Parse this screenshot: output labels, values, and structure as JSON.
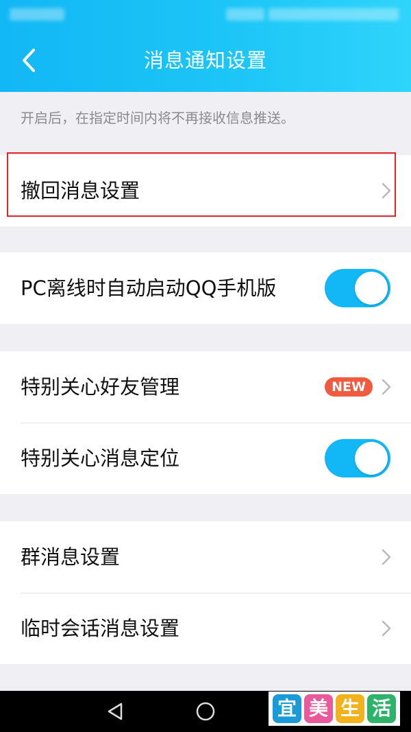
{
  "header": {
    "title": "消息通知设置",
    "back_icon": "chevron-left-icon",
    "color": "#12b7f5"
  },
  "hint_text": "开启后，在指定时间内将不再接收信息推送。",
  "groups": [
    {
      "items": [
        {
          "label": "撤回消息设置",
          "control": "chevron",
          "highlighted": true
        }
      ]
    },
    {
      "items": [
        {
          "label": "PC离线时自动启动QQ手机版",
          "control": "toggle",
          "checked": true
        }
      ]
    },
    {
      "items": [
        {
          "label": "特别关心好友管理",
          "control": "chevron",
          "badge": "NEW"
        },
        {
          "label": "特别关心消息定位",
          "control": "toggle",
          "checked": true
        }
      ]
    },
    {
      "items": [
        {
          "label": "群消息设置",
          "control": "chevron"
        },
        {
          "label": "临时会话消息设置",
          "control": "chevron"
        }
      ]
    }
  ],
  "navbar": {
    "back_icon": "triangle-back-icon",
    "home_icon": "circle-home-icon"
  },
  "watermark": {
    "chars": [
      "宜",
      "美",
      "生",
      "活"
    ],
    "colors": [
      "#1a9ad6",
      "#e85a9a",
      "#f3b21b",
      "#2fb36a"
    ]
  },
  "colors": {
    "accent": "#12b7f5",
    "badge": "#f05a3f",
    "highlight": "#e0242a"
  }
}
